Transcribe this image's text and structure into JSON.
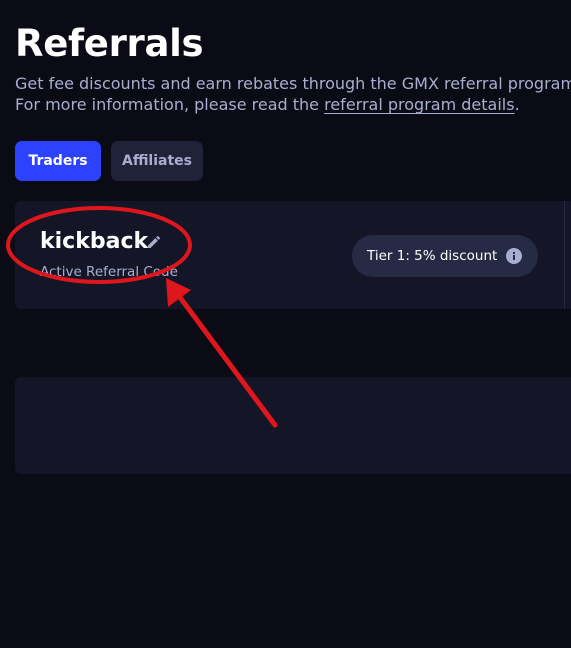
{
  "page": {
    "title": "Referrals",
    "subtitle_line1": "Get fee discounts and earn rebates through the GMX referral program.",
    "subtitle_line2_prefix": "For more information, please read the ",
    "subtitle_link": "referral program details",
    "subtitle_line2_suffix": "."
  },
  "tabs": [
    {
      "label": "Traders",
      "active": true
    },
    {
      "label": "Affiliates",
      "active": false
    }
  ],
  "referral_card": {
    "code": "kickback",
    "caption": "Active Referral Code",
    "edit_icon": "pencil-icon",
    "tier_label": "Tier 1: 5% discount",
    "tier_icon": "info-icon"
  },
  "colors": {
    "background": "#0b0b16",
    "card": "#141628",
    "accent": "#2d42fc",
    "muted_text": "#a9aecf",
    "annotation": "#e0161d"
  }
}
